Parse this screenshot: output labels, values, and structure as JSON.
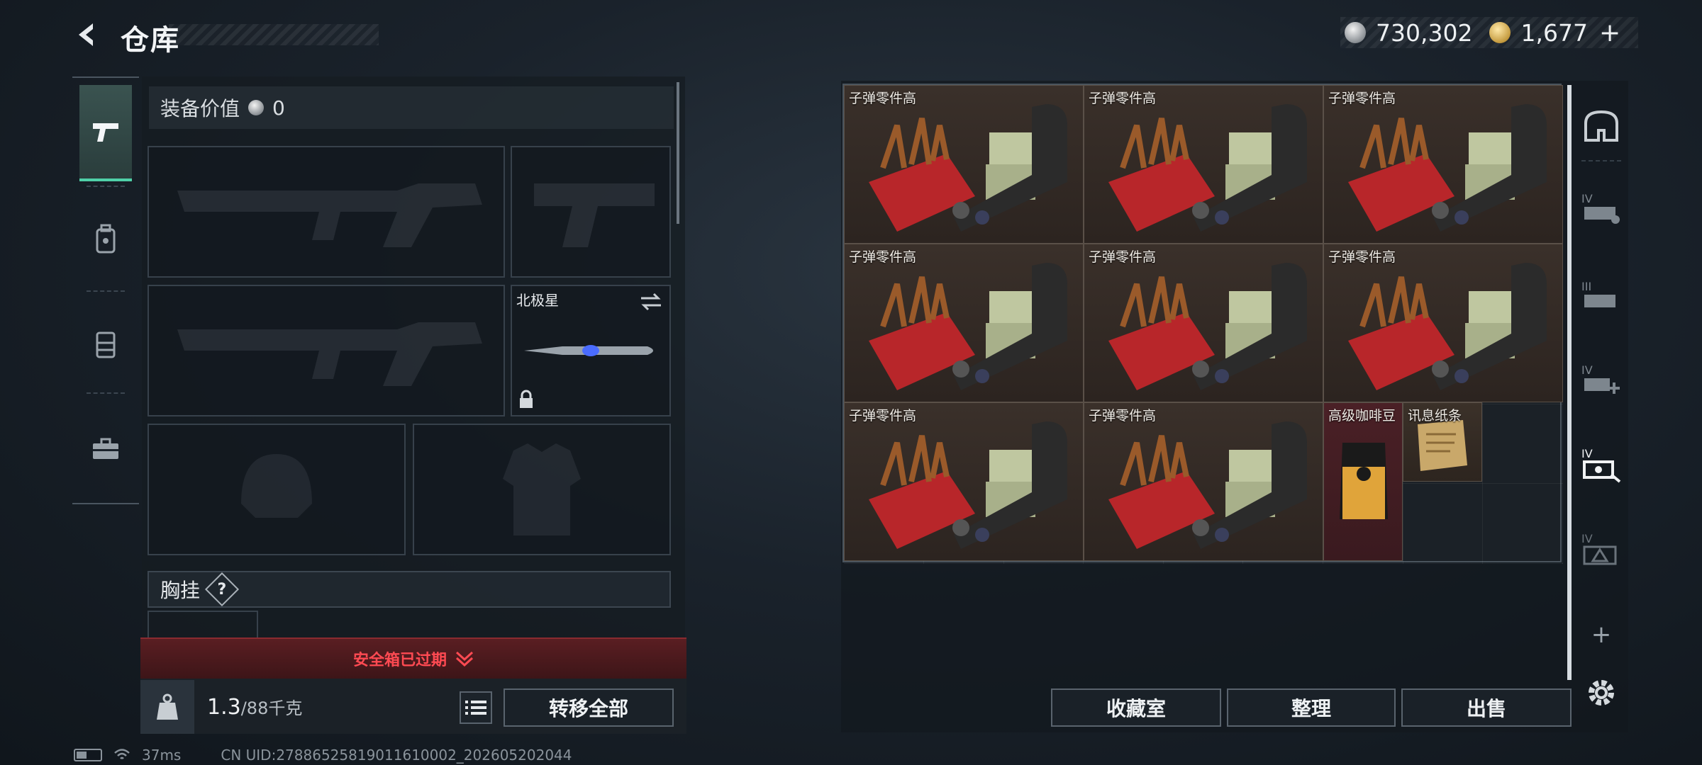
{
  "header": {
    "title": "仓库",
    "silver_amount": "730,302",
    "gold_amount": "1,677",
    "plus_label": "+"
  },
  "equipment": {
    "value_label": "装备价值",
    "value": "0",
    "melee_name": "北极星",
    "chest_rig_label": "胸挂",
    "help_label": "?",
    "expired_text": "安全箱已过期",
    "weight_current": "1.3",
    "weight_max": "/88千克",
    "transfer_all_label": "转移全部"
  },
  "stash": {
    "items": [
      {
        "name": "子弹零件高"
      },
      {
        "name": "子弹零件高"
      },
      {
        "name": "子弹零件高"
      },
      {
        "name": "子弹零件高"
      },
      {
        "name": "子弹零件高"
      },
      {
        "name": "子弹零件高"
      },
      {
        "name": "子弹零件高"
      },
      {
        "name": "子弹零件高"
      },
      {
        "name": "高级咖啡豆"
      },
      {
        "name": "讯息纸条"
      }
    ],
    "add_label": "+",
    "collection_label": "收藏室",
    "organize_label": "整理",
    "sell_label": "出售"
  },
  "status_bar": {
    "ping": "37ms",
    "uid": "CN UID:27886525819011610002_202605202044"
  },
  "colors": {
    "accent": "#4fd0a8",
    "warning": "#ff4a52"
  }
}
